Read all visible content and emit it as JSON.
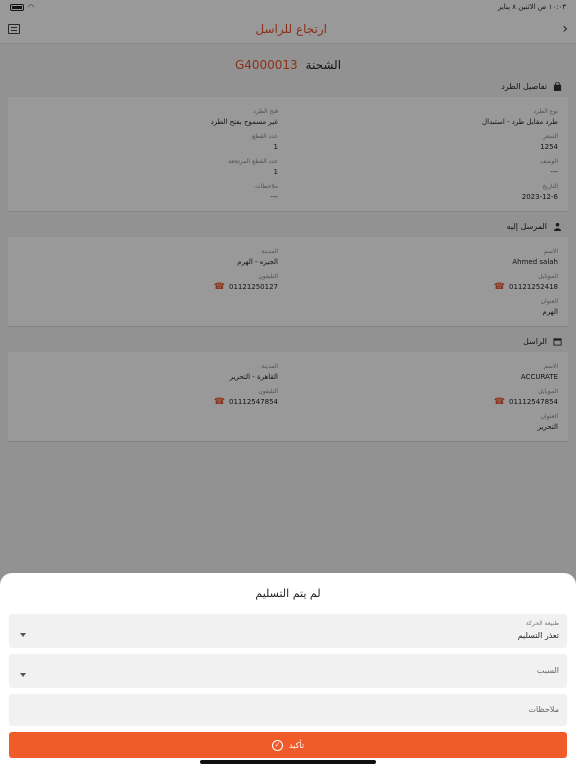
{
  "status_bar": {
    "time": "١٠:٠٣ ص",
    "date": "الاثنين ٨ يناير"
  },
  "header": {
    "title": "ارتجاع للراسل"
  },
  "shipment": {
    "label": "الشحنة",
    "code": "G4000013"
  },
  "package_details": {
    "title": "تفاصيل الطرد",
    "fields": [
      {
        "label": "نوع الطرد",
        "value": "طرد مقابل طرد - استبدال"
      },
      {
        "label": "فتح الطرد",
        "value": "غير مسموح بفتح الطرد"
      },
      {
        "label": "السعر",
        "value": "1254"
      },
      {
        "label": "عدد القطع",
        "value": "1"
      },
      {
        "label": "الوصف",
        "value": "---"
      },
      {
        "label": "عدد القطع المرتجعة",
        "value": "1"
      },
      {
        "label": "التاريخ",
        "value": "2023-12-6"
      },
      {
        "label": "ملاحظات",
        "value": "---"
      }
    ]
  },
  "recipient": {
    "title": "المرسل إليه",
    "name_label": "الاسم",
    "name": "Ahmed salah",
    "city_label": "المدينة",
    "city": "الجيزه - الهرم",
    "mobile_label": "الموبايل",
    "mobile": "01121252418",
    "phone_label": "التليفون",
    "phone": "01121250127",
    "address_label": "العنوان",
    "address": "الهرم"
  },
  "sender": {
    "title": "الراسل",
    "name_label": "الاسم",
    "name": "ACCURATE",
    "city_label": "المدينة",
    "city": "القاهرة - التحرير",
    "mobile_label": "الموبايل",
    "mobile": "01112547854",
    "phone_label": "التليفون",
    "phone": "01112547854",
    "address_label": "العنوان",
    "address": "التحرير"
  },
  "sheet": {
    "title": "لم يتم التسليم",
    "movement_type_label": "طبيعة الحركة",
    "movement_type_value": "تعذر التسليم",
    "reason_placeholder": "السبب",
    "notes_placeholder": "ملاحظات",
    "confirm_label": "تأكيد"
  },
  "colors": {
    "accent": "#e8532a",
    "button": "#f05b2a"
  }
}
